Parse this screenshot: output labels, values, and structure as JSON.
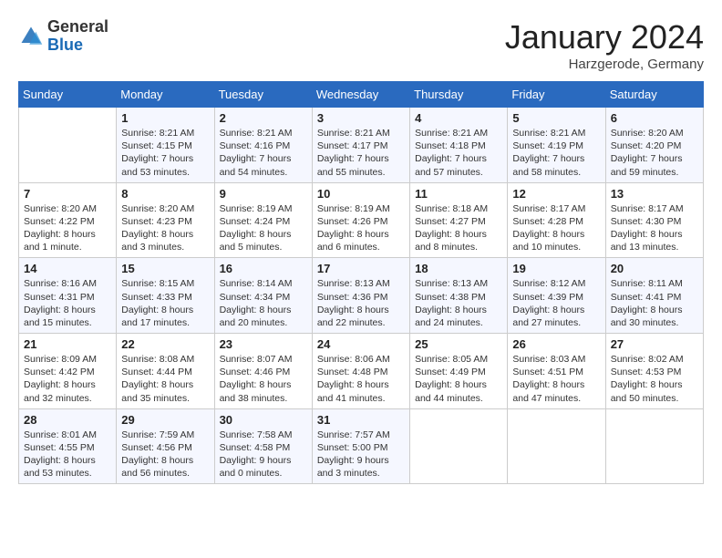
{
  "logo": {
    "general": "General",
    "blue": "Blue"
  },
  "title": "January 2024",
  "location": "Harzgerode, Germany",
  "weekdays": [
    "Sunday",
    "Monday",
    "Tuesday",
    "Wednesday",
    "Thursday",
    "Friday",
    "Saturday"
  ],
  "weeks": [
    [
      {
        "day": "",
        "info": ""
      },
      {
        "day": "1",
        "info": "Sunrise: 8:21 AM\nSunset: 4:15 PM\nDaylight: 7 hours\nand 53 minutes."
      },
      {
        "day": "2",
        "info": "Sunrise: 8:21 AM\nSunset: 4:16 PM\nDaylight: 7 hours\nand 54 minutes."
      },
      {
        "day": "3",
        "info": "Sunrise: 8:21 AM\nSunset: 4:17 PM\nDaylight: 7 hours\nand 55 minutes."
      },
      {
        "day": "4",
        "info": "Sunrise: 8:21 AM\nSunset: 4:18 PM\nDaylight: 7 hours\nand 57 minutes."
      },
      {
        "day": "5",
        "info": "Sunrise: 8:21 AM\nSunset: 4:19 PM\nDaylight: 7 hours\nand 58 minutes."
      },
      {
        "day": "6",
        "info": "Sunrise: 8:20 AM\nSunset: 4:20 PM\nDaylight: 7 hours\nand 59 minutes."
      }
    ],
    [
      {
        "day": "7",
        "info": "Sunrise: 8:20 AM\nSunset: 4:22 PM\nDaylight: 8 hours\nand 1 minute."
      },
      {
        "day": "8",
        "info": "Sunrise: 8:20 AM\nSunset: 4:23 PM\nDaylight: 8 hours\nand 3 minutes."
      },
      {
        "day": "9",
        "info": "Sunrise: 8:19 AM\nSunset: 4:24 PM\nDaylight: 8 hours\nand 5 minutes."
      },
      {
        "day": "10",
        "info": "Sunrise: 8:19 AM\nSunset: 4:26 PM\nDaylight: 8 hours\nand 6 minutes."
      },
      {
        "day": "11",
        "info": "Sunrise: 8:18 AM\nSunset: 4:27 PM\nDaylight: 8 hours\nand 8 minutes."
      },
      {
        "day": "12",
        "info": "Sunrise: 8:17 AM\nSunset: 4:28 PM\nDaylight: 8 hours\nand 10 minutes."
      },
      {
        "day": "13",
        "info": "Sunrise: 8:17 AM\nSunset: 4:30 PM\nDaylight: 8 hours\nand 13 minutes."
      }
    ],
    [
      {
        "day": "14",
        "info": "Sunrise: 8:16 AM\nSunset: 4:31 PM\nDaylight: 8 hours\nand 15 minutes."
      },
      {
        "day": "15",
        "info": "Sunrise: 8:15 AM\nSunset: 4:33 PM\nDaylight: 8 hours\nand 17 minutes."
      },
      {
        "day": "16",
        "info": "Sunrise: 8:14 AM\nSunset: 4:34 PM\nDaylight: 8 hours\nand 20 minutes."
      },
      {
        "day": "17",
        "info": "Sunrise: 8:13 AM\nSunset: 4:36 PM\nDaylight: 8 hours\nand 22 minutes."
      },
      {
        "day": "18",
        "info": "Sunrise: 8:13 AM\nSunset: 4:38 PM\nDaylight: 8 hours\nand 24 minutes."
      },
      {
        "day": "19",
        "info": "Sunrise: 8:12 AM\nSunset: 4:39 PM\nDaylight: 8 hours\nand 27 minutes."
      },
      {
        "day": "20",
        "info": "Sunrise: 8:11 AM\nSunset: 4:41 PM\nDaylight: 8 hours\nand 30 minutes."
      }
    ],
    [
      {
        "day": "21",
        "info": "Sunrise: 8:09 AM\nSunset: 4:42 PM\nDaylight: 8 hours\nand 32 minutes."
      },
      {
        "day": "22",
        "info": "Sunrise: 8:08 AM\nSunset: 4:44 PM\nDaylight: 8 hours\nand 35 minutes."
      },
      {
        "day": "23",
        "info": "Sunrise: 8:07 AM\nSunset: 4:46 PM\nDaylight: 8 hours\nand 38 minutes."
      },
      {
        "day": "24",
        "info": "Sunrise: 8:06 AM\nSunset: 4:48 PM\nDaylight: 8 hours\nand 41 minutes."
      },
      {
        "day": "25",
        "info": "Sunrise: 8:05 AM\nSunset: 4:49 PM\nDaylight: 8 hours\nand 44 minutes."
      },
      {
        "day": "26",
        "info": "Sunrise: 8:03 AM\nSunset: 4:51 PM\nDaylight: 8 hours\nand 47 minutes."
      },
      {
        "day": "27",
        "info": "Sunrise: 8:02 AM\nSunset: 4:53 PM\nDaylight: 8 hours\nand 50 minutes."
      }
    ],
    [
      {
        "day": "28",
        "info": "Sunrise: 8:01 AM\nSunset: 4:55 PM\nDaylight: 8 hours\nand 53 minutes."
      },
      {
        "day": "29",
        "info": "Sunrise: 7:59 AM\nSunset: 4:56 PM\nDaylight: 8 hours\nand 56 minutes."
      },
      {
        "day": "30",
        "info": "Sunrise: 7:58 AM\nSunset: 4:58 PM\nDaylight: 9 hours\nand 0 minutes."
      },
      {
        "day": "31",
        "info": "Sunrise: 7:57 AM\nSunset: 5:00 PM\nDaylight: 9 hours\nand 3 minutes."
      },
      {
        "day": "",
        "info": ""
      },
      {
        "day": "",
        "info": ""
      },
      {
        "day": "",
        "info": ""
      }
    ]
  ]
}
